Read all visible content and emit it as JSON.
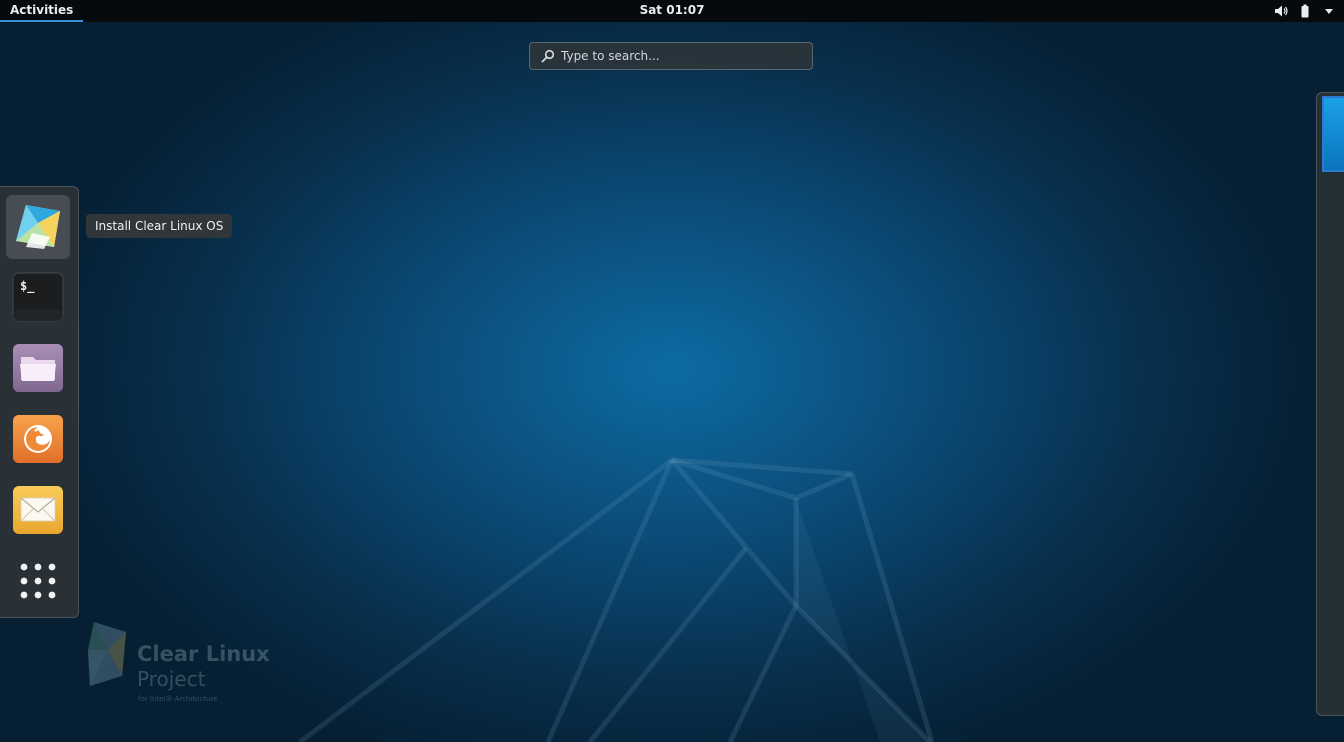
{
  "topbar": {
    "activities_label": "Activities",
    "clock": "Sat 01:07",
    "status_icons": [
      "volume-icon",
      "battery-icon",
      "dropdown-arrow-icon"
    ]
  },
  "search": {
    "placeholder": "Type to search..."
  },
  "dash": {
    "items": [
      {
        "name": "Install Clear Linux OS",
        "icon": "clear-linux-installer-icon",
        "selected": true
      },
      {
        "name": "Terminal",
        "icon": "terminal-icon",
        "glyph": "$_"
      },
      {
        "name": "Files",
        "icon": "folder-icon"
      },
      {
        "name": "Firefox",
        "icon": "firefox-icon"
      },
      {
        "name": "Mail",
        "icon": "mail-icon"
      },
      {
        "name": "Show Applications",
        "icon": "app-grid-icon"
      }
    ],
    "tooltip": "Install Clear Linux OS"
  },
  "watermark": {
    "title": "Clear Linux",
    "subtitle": "Project",
    "tagline": "for Intel® Architecture"
  },
  "colors": {
    "accent": "#3d8fd6",
    "topbar_bg": "#060a0d",
    "desktop_center": "#0d6ba3",
    "desktop_edge": "#061f33"
  }
}
